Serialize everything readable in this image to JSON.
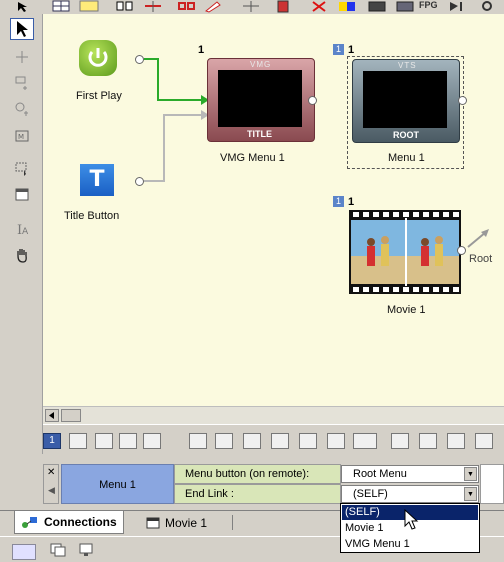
{
  "toolbar": {
    "fpg_label": "FPG"
  },
  "canvas": {
    "first_play": {
      "label": "First Play"
    },
    "title_button": {
      "label": "Title Button",
      "icon_letter": "T"
    },
    "vmg_menu": {
      "label": "VMG Menu 1",
      "top_tag": "VMG",
      "bottom_tag": "TITLE",
      "count": "1"
    },
    "menu1": {
      "label": "Menu 1",
      "top_tag": "VTS",
      "bottom_tag": "ROOT",
      "badge": "1",
      "count": "1"
    },
    "movie1": {
      "label": "Movie 1",
      "badge": "1",
      "count": "1",
      "link_text": "Root"
    }
  },
  "bottom_toolbar": {
    "chapter_button": "1"
  },
  "properties": {
    "object_name": "Menu 1",
    "row1": {
      "label": "Menu button (on remote):",
      "value": "Root Menu"
    },
    "row2": {
      "label": "End Link :",
      "value": "(SELF)"
    }
  },
  "dropdown": {
    "options": [
      "(SELF)",
      "Movie 1",
      "VMG Menu 1"
    ],
    "selected_index": 0
  },
  "tabs": [
    {
      "label": "Connections",
      "active": true
    },
    {
      "label": "Movie 1",
      "active": false
    }
  ],
  "colors": {
    "canvas_bg": "#fbfadf",
    "selection_blue": "#0a246a",
    "name_cell": "#8aa6e0",
    "connection_green": "#2aaa2a"
  }
}
